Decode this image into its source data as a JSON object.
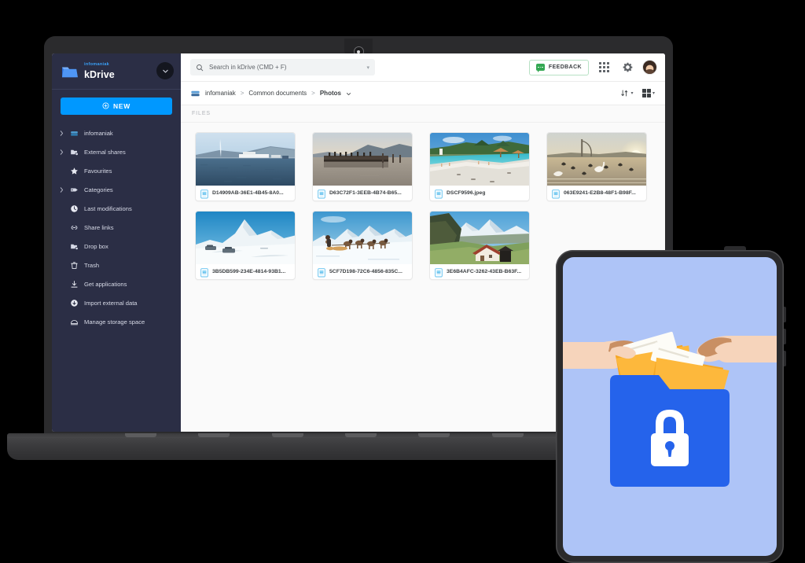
{
  "brand": {
    "company": "infomaniak",
    "product": "kDrive",
    "logo_icon": "folder-logo-icon",
    "account_chevron_icon": "chevron-down-icon"
  },
  "sidebar": {
    "new_button": {
      "label": "NEW",
      "icon": "plus-circle-icon"
    },
    "items": [
      {
        "label": "infomaniak",
        "icon": "drive-icon",
        "expandable": true
      },
      {
        "label": "External shares",
        "icon": "external-share-icon",
        "expandable": true
      },
      {
        "label": "Favourites",
        "icon": "star-icon",
        "expandable": false
      },
      {
        "label": "Categories",
        "icon": "tag-icon",
        "expandable": true
      },
      {
        "label": "Last modifications",
        "icon": "clock-icon",
        "expandable": false
      },
      {
        "label": "Share links",
        "icon": "link-icon",
        "expandable": false
      },
      {
        "label": "Drop box",
        "icon": "dropbox-folder-icon",
        "expandable": false
      },
      {
        "label": "Trash",
        "icon": "trash-icon",
        "expandable": false
      },
      {
        "label": "Get applications",
        "icon": "download-icon",
        "expandable": false
      },
      {
        "label": "Import external data",
        "icon": "import-icon",
        "expandable": false
      },
      {
        "label": "Manage storage space",
        "icon": "storage-icon",
        "expandable": false
      }
    ]
  },
  "topbar": {
    "search_placeholder": "Search in kDrive (CMD + F)",
    "search_value": "",
    "search_icon": "search-icon",
    "search_caret_icon": "caret-down-icon",
    "feedback_label": "FEEDBACK",
    "feedback_icon": "chat-bubble-icon",
    "apps_icon": "apps-grid-icon",
    "settings_icon": "gear-icon",
    "avatar_icon": "user-avatar"
  },
  "breadcrumb": {
    "drive_icon": "drive-icon",
    "items": [
      "infomaniak",
      "Common documents",
      "Photos"
    ],
    "separator": ">",
    "current_caret_icon": "chevron-down-icon",
    "sort_icon": "sort-arrows-icon",
    "sort_caret_icon": "caret-down-icon",
    "view_icon": "grid-view-icon",
    "view_caret_icon": "caret-down-icon"
  },
  "content": {
    "section_label": "FILES",
    "files": [
      {
        "name": "D14909AB-36E1-4B45-8A0...",
        "icon": "image-file-icon",
        "scene": "lake-geneva-jet-deau"
      },
      {
        "name": "D63C72F1-3EEB-4B74-B65...",
        "icon": "image-file-icon",
        "scene": "pier-sunset-lake"
      },
      {
        "name": "DSCF9596.jpeg",
        "icon": "image-file-icon",
        "scene": "beach-turquoise-water"
      },
      {
        "name": "063E9241-E2B8-48F1-B98F...",
        "icon": "image-file-icon",
        "scene": "swans-sunset-lake"
      },
      {
        "name": "3B5DB599-234E-4814-93B1...",
        "icon": "image-file-icon",
        "scene": "matterhorn-snow"
      },
      {
        "name": "5CF7D198-72C6-4856-835C...",
        "icon": "image-file-icon",
        "scene": "sled-dogs-mountains"
      },
      {
        "name": "3E6B4AFC-3262-43EB-B63F...",
        "icon": "image-file-icon",
        "scene": "alpine-chalet-valley"
      }
    ]
  },
  "tablet": {
    "illustration": "hands-passing-folders-with-locked-folder",
    "screen_color": "#aec4f7",
    "locked_folder_icon": "locked-folder-icon",
    "folder_color": "#2563eb",
    "lock_color": "#ffffff",
    "document_folder_color": "#f5a623"
  },
  "colors": {
    "sidebar_bg": "#2b2e45",
    "accent_blue": "#0098ff",
    "brand_blue": "#3a9ff5",
    "feedback_green": "#34a853",
    "content_bg": "#fafafa",
    "device_frame": "#2b2b2d"
  }
}
